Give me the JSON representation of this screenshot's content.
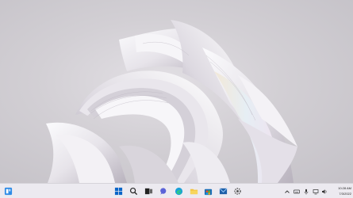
{
  "desktop": {
    "wallpaper": "bloom-wallpaper",
    "colors": {
      "background": "#cfccd1",
      "taskbar": "#eceaf0",
      "accent": "#0a66c8"
    }
  },
  "taskbar": {
    "left_widget_icon": "widgets-icon",
    "center_icons": [
      "start-icon",
      "search-icon",
      "task-view-icon",
      "widgets-chat-icon",
      "edge-icon",
      "file-explorer-icon",
      "store-icon",
      "mail-icon",
      "settings-icon"
    ],
    "tray_icons": [
      "chevron-up-icon",
      "keyboard-icon",
      "microphone-icon",
      "network-icon",
      "volume-icon"
    ],
    "clock": {
      "time": "10:28 AM",
      "date": "7/3/2022"
    }
  }
}
